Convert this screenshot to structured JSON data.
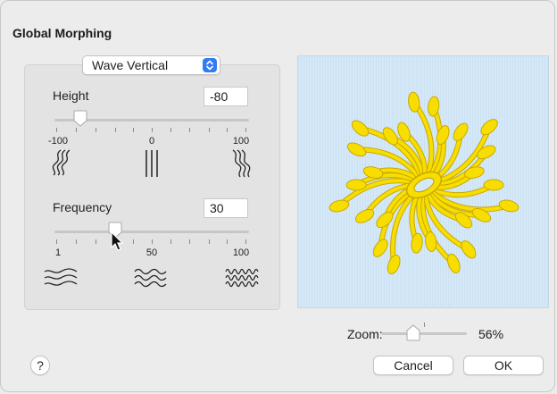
{
  "dialog": {
    "title": "Global Morphing"
  },
  "effect_select": {
    "value": "Wave Vertical"
  },
  "height": {
    "label": "Height",
    "value": "-80",
    "slider_value": -80,
    "range": [
      -100,
      100
    ],
    "tick_labels": [
      "-100",
      "0",
      "100"
    ]
  },
  "frequency": {
    "label": "Frequency",
    "value": "30",
    "slider_value": 30,
    "range": [
      1,
      100
    ],
    "tick_labels": [
      "1",
      "50",
      "100"
    ]
  },
  "zoom": {
    "label": "Zoom:",
    "value": "56%",
    "slider_value": 56
  },
  "buttons": {
    "help": "?",
    "cancel": "Cancel",
    "ok": "OK"
  },
  "colors": {
    "accent": "#2f7cf6",
    "preview_bg": "#d4e8f7",
    "petal": "#f7de00",
    "petal_edge": "#c9a800"
  },
  "icons": {
    "height_low": "wavy-lines-left-icon",
    "height_mid": "straight-lines-icon",
    "height_high": "wavy-lines-right-icon",
    "freq_low": "low-frequency-wave-icon",
    "freq_mid": "medium-frequency-wave-icon",
    "freq_high": "high-frequency-wave-icon"
  }
}
